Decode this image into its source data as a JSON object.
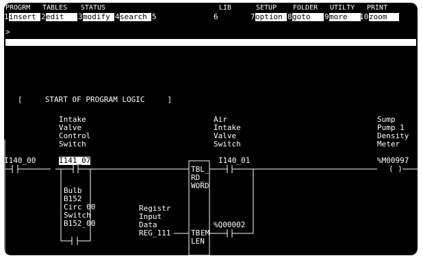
{
  "menu": {
    "categories": [
      "PROGRM",
      "TABLES",
      "STATUS",
      "",
      "",
      "LIB",
      "SETUP",
      "FOLDER",
      "UTILTY",
      "PRINT"
    ],
    "keys": [
      {
        "num": "1",
        "label": "insert"
      },
      {
        "num": "2",
        "label": "edit"
      },
      {
        "num": "3",
        "label": "modify"
      },
      {
        "num": "4",
        "label": "search"
      },
      {
        "num": "5",
        "label": ""
      },
      {
        "num": "6",
        "label": ""
      },
      {
        "num": "7",
        "label": "option"
      },
      {
        "num": "8",
        "label": "goto"
      },
      {
        "num": "9",
        "label": "more"
      },
      {
        "num": "10",
        "label": "zoom"
      }
    ]
  },
  "command_line": {
    "prompt": ">"
  },
  "program": {
    "start_comment": "[     START OF PROGRAM LOGIC     ]",
    "rung1_contact1": {
      "address": "I140_00"
    },
    "rung1_contact2": {
      "desc": [
        "Intake",
        "Valve",
        "Control",
        "Switch"
      ],
      "address": "I141_07"
    },
    "branch_contact": {
      "desc": [
        "Bulb",
        "B152",
        "Circ 00",
        "Switch"
      ],
      "address": "B152_00"
    },
    "function_block": {
      "lines": [
        "TBL_",
        "RD_",
        "WORD"
      ],
      "in_label": "TB",
      "out_label": "EM",
      "len_label": "LEN"
    },
    "register_input": {
      "desc": [
        "Registr",
        "Input",
        "Data"
      ],
      "address": "REG_111"
    },
    "air_contact": {
      "desc": [
        "Air",
        "Intake",
        "Valve",
        "Switch"
      ],
      "address": "I140_01"
    },
    "q_contact": {
      "address": "%Q00002"
    },
    "coil": {
      "desc": [
        "Sump",
        "Pump 1",
        "Density",
        "Meter"
      ],
      "address": "%M00997",
      "symbol": "( )"
    }
  }
}
